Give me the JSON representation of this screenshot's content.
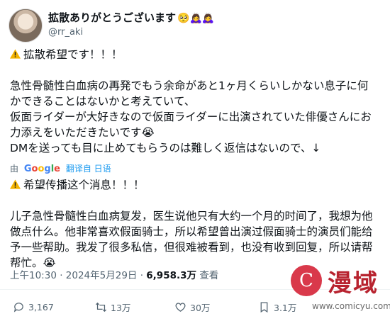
{
  "post": {
    "display_name": "拡散ありがとうございます",
    "display_name_emojis": "🥺🙇‍♀️🙇‍♀️",
    "handle": "@rr_aki",
    "body_lines": [
      "拡散希望です！！！",
      "",
      "急性骨髄性白血病の再発でもう余命があと1ヶ月くらいしかない息子に何",
      "かできることはないかと考えていて、",
      "仮面ライダーが大好きなので仮面ライダーに出演されていた俳優さんにお",
      "力添えをいただきたいです😭",
      "DMを送っても目に止めてもらうのは難しく返信はないので、↓"
    ],
    "translate": {
      "by_label": "由",
      "provider": "Google",
      "link_label": "翻译自 日语"
    },
    "translated_lines": [
      "希望传播这个消息！！！",
      "",
      "儿子急性骨髓性白血病复发，医生说他只有大约一个月的时间了，我想为他",
      "做点什么。他非常喜欢假面骑士，所以希望曾出演过假面骑士的演员们能给",
      "予一些帮助。我发了很多私信，但很难被看到，也没有收到回复，所以请帮",
      "帮忙。😭"
    ],
    "time": "上午10:30",
    "date": "2024年5月29日",
    "views_count": "6,958.3万",
    "views_label": "查看"
  },
  "actions": {
    "replies": "3,167",
    "reposts": "13万",
    "likes": "30万",
    "bookmarks": "3.1万"
  },
  "watermark": {
    "name": "漫域",
    "url": "www.comicyu.com",
    "logo_glyph": "C"
  },
  "colors": {
    "text": "#0f1419",
    "secondary": "#536471",
    "link": "#1d9bf0",
    "warning": "#f4b400",
    "watermark_red": "#b8232f"
  }
}
